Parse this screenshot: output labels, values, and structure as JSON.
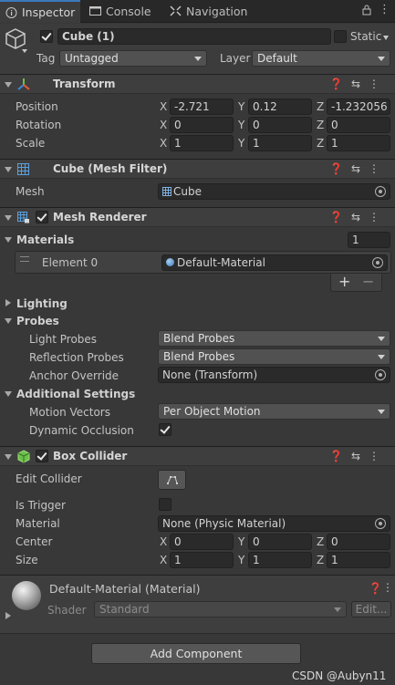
{
  "tabs": [
    {
      "label": "Inspector",
      "icon": "info-icon"
    },
    {
      "label": "Console",
      "icon": "console-icon"
    },
    {
      "label": "Navigation",
      "icon": "navigation-icon"
    }
  ],
  "object": {
    "name": "Cube (1)",
    "active": true,
    "static_label": "Static",
    "tag_label": "Tag",
    "tag_value": "Untagged",
    "layer_label": "Layer",
    "layer_value": "Default"
  },
  "transform": {
    "title": "Transform",
    "position_label": "Position",
    "rotation_label": "Rotation",
    "scale_label": "Scale",
    "position": {
      "x": "-2.721",
      "y": "0.12",
      "z": "-1.232056"
    },
    "rotation": {
      "x": "0",
      "y": "0",
      "z": "0"
    },
    "scale": {
      "x": "1",
      "y": "1",
      "z": "1"
    }
  },
  "axes": {
    "x": "X",
    "y": "Y",
    "z": "Z"
  },
  "mesh_filter": {
    "title": "Cube (Mesh Filter)",
    "mesh_label": "Mesh",
    "mesh_value": "Cube"
  },
  "mesh_renderer": {
    "title": "Mesh Renderer",
    "materials_label": "Materials",
    "materials_count": "1",
    "element_label": "Element 0",
    "element_value": "Default-Material",
    "add_label": "+",
    "remove_label": "−",
    "lighting_label": "Lighting",
    "probes_label": "Probes",
    "light_probes_label": "Light Probes",
    "light_probes_value": "Blend Probes",
    "reflection_probes_label": "Reflection Probes",
    "reflection_probes_value": "Blend Probes",
    "anchor_override_label": "Anchor Override",
    "anchor_override_value": "None (Transform)",
    "additional_label": "Additional Settings",
    "motion_vectors_label": "Motion Vectors",
    "motion_vectors_value": "Per Object Motion",
    "dynamic_occlusion_label": "Dynamic Occlusion",
    "dynamic_occlusion": true
  },
  "box_collider": {
    "title": "Box Collider",
    "edit_collider_label": "Edit Collider",
    "is_trigger_label": "Is Trigger",
    "is_trigger": false,
    "material_label": "Material",
    "material_value": "None (Physic Material)",
    "center_label": "Center",
    "size_label": "Size",
    "center": {
      "x": "0",
      "y": "0",
      "z": "0"
    },
    "size": {
      "x": "1",
      "y": "1",
      "z": "1"
    }
  },
  "material": {
    "title": "Default-Material (Material)",
    "shader_label": "Shader",
    "shader_value": "Standard",
    "edit_label": "Edit..."
  },
  "add_component_label": "Add Component",
  "watermark": "CSDN @Aubyn11",
  "colors": {
    "background": "#383838",
    "header": "#3e3e3e",
    "field": "#2a2a2a",
    "accent": "#3a79bb"
  }
}
